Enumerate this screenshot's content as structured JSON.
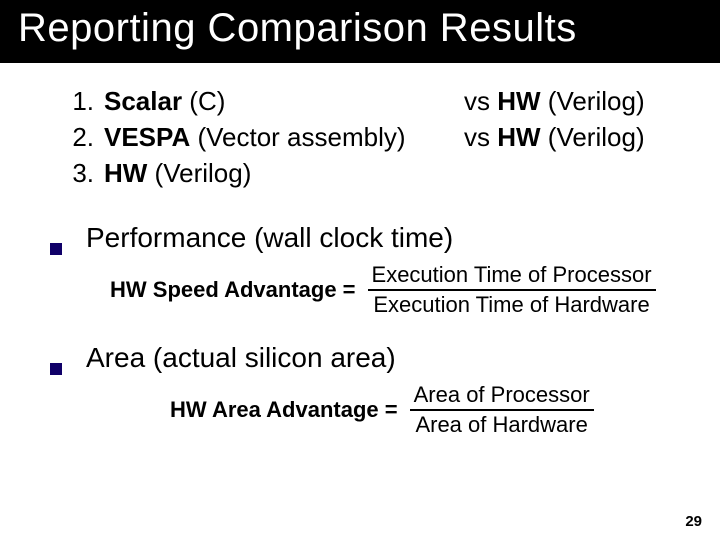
{
  "title": "Reporting Comparison Results",
  "list": {
    "items": [
      {
        "num": "1.",
        "bold": "Scalar",
        "rest": " (C)",
        "vs_prefix": "vs ",
        "vs_bold": "HW",
        "vs_rest": " (Verilog)"
      },
      {
        "num": "2.",
        "bold": "VESPA",
        "rest": " (Vector assembly)",
        "vs_prefix": "vs ",
        "vs_bold": "HW",
        "vs_rest": " (Verilog)"
      },
      {
        "num": "3.",
        "bold": "HW",
        "rest": " (Verilog)",
        "vs_prefix": "",
        "vs_bold": "",
        "vs_rest": ""
      }
    ]
  },
  "bullets": {
    "perf": "Performance (wall clock time)",
    "area": "Area (actual silicon area)"
  },
  "formula1": {
    "lhs": "HW Speed Advantage  =",
    "top": "Execution Time of Processor",
    "bot": "Execution Time of Hardware"
  },
  "formula2": {
    "lhs": "HW Area Advantage =",
    "top": "Area of Processor",
    "bot": "Area of Hardware"
  },
  "slide_number": "29"
}
